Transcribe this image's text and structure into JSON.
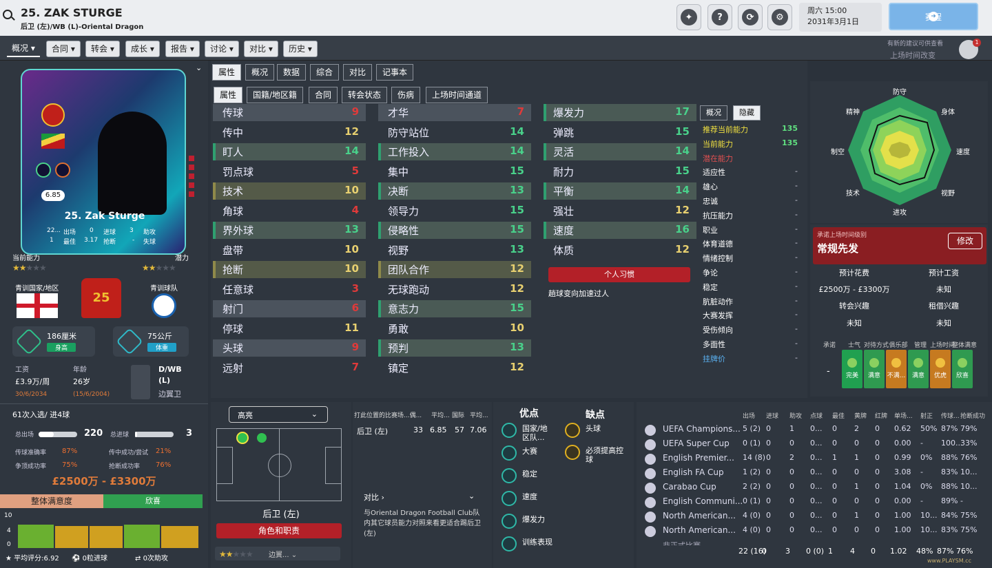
{
  "header": {
    "title": "25. ZAK STURGE",
    "subtitle": "后卫 (左)/WB (L)-Oriental Dragon",
    "day_time": "周六 15:00",
    "date": "2031年3月1日",
    "continue_label": "赛程",
    "help": "?"
  },
  "nav": {
    "tabs": [
      "概况",
      "合同",
      "转会",
      "成长",
      "报告",
      "讨论",
      "对比",
      "历史"
    ],
    "notif1": "有新的建议可供查看",
    "notif2": "上场时间改变",
    "notif_count": "1"
  },
  "card": {
    "rating": "6.85",
    "name": "25. Zak Sturge",
    "stats": [
      [
        "22...",
        "出场"
      ],
      [
        "0",
        "进球"
      ],
      [
        "3",
        "助攻"
      ],
      [
        "1",
        "最佳"
      ],
      [
        "3.17",
        "抢断"
      ],
      [
        "-",
        "失球"
      ]
    ],
    "current_label": "当前能力",
    "potential_label": "潜力"
  },
  "left": {
    "nation_label": "青训国家/地区",
    "club_label": "青训球队",
    "height": "186厘米",
    "height_tag": "身高",
    "weight": "75公斤",
    "weight_tag": "体重",
    "wage_label": "工资",
    "wage": "£3.9万/周",
    "wage_end": "30/6/2034",
    "age_label": "年龄",
    "age": "26岁",
    "dob": "(15/6/2004)",
    "pos1": "D/WB",
    "pos2": "(L)",
    "pos3": "边翼卫",
    "call": "61次入选/ 进4球",
    "apps_label": "总出场",
    "apps": "220",
    "goals_label": "总进球",
    "goals": "3",
    "pass_label": "传球准确率",
    "pass": "87%",
    "cross_label": "传中成功/尝试",
    "cross": "21%",
    "head_label": "争顶成功率",
    "head": "75%",
    "tackle_label": "抢断成功率",
    "tackle": "76%",
    "value": "£2500万 - £3300万",
    "sat_label": "整体满意度",
    "sat": "欣喜",
    "avg": "平均评分:6.92",
    "g0": "0粒进球",
    "a0": "0次助攻",
    "shirt": "25",
    "y10": "10",
    "y4": "4",
    "y0": "0"
  },
  "tabs1": [
    "属性",
    "概况",
    "数据",
    "综合",
    "对比",
    "记事本"
  ],
  "tabs2": [
    "属性",
    "国籍/地区籍",
    "合同",
    "转会状态",
    "伤病",
    "上场时间通道"
  ],
  "attrs1": [
    [
      "传球",
      "9",
      "r"
    ],
    [
      "传中",
      "12",
      "y"
    ],
    [
      "盯人",
      "14",
      "g"
    ],
    [
      "罚点球",
      "5",
      "r"
    ],
    [
      "技术",
      "10",
      "y"
    ],
    [
      "角球",
      "4",
      "r"
    ],
    [
      "界外球",
      "13",
      "g"
    ],
    [
      "盘带",
      "10",
      "y"
    ],
    [
      "抢断",
      "10",
      "y"
    ],
    [
      "任意球",
      "3",
      "r"
    ],
    [
      "射门",
      "6",
      "r"
    ],
    [
      "停球",
      "11",
      "y"
    ],
    [
      "头球",
      "9",
      "r"
    ],
    [
      "远射",
      "7",
      "r"
    ]
  ],
  "attrs2": [
    [
      "才华",
      "7",
      "r"
    ],
    [
      "防守站位",
      "14",
      "g"
    ],
    [
      "工作投入",
      "14",
      "g"
    ],
    [
      "集中",
      "15",
      "g"
    ],
    [
      "决断",
      "13",
      "g"
    ],
    [
      "领导力",
      "15",
      "g"
    ],
    [
      "侵略性",
      "15",
      "g"
    ],
    [
      "视野",
      "13",
      "g"
    ],
    [
      "团队合作",
      "12",
      "y"
    ],
    [
      "无球跑动",
      "12",
      "y"
    ],
    [
      "意志力",
      "15",
      "g"
    ],
    [
      "勇敢",
      "10",
      "y"
    ],
    [
      "预判",
      "13",
      "g"
    ],
    [
      "镇定",
      "12",
      "y"
    ]
  ],
  "attrs3": [
    [
      "爆发力",
      "17",
      "g"
    ],
    [
      "弹跳",
      "15",
      "g"
    ],
    [
      "灵活",
      "14",
      "g"
    ],
    [
      "耐力",
      "15",
      "g"
    ],
    [
      "平衡",
      "14",
      "g"
    ],
    [
      "强壮",
      "12",
      "y"
    ],
    [
      "速度",
      "16",
      "g"
    ],
    [
      "体质",
      "12",
      "y"
    ]
  ],
  "habit_label": "个人习惯",
  "habit": "趟球变向加速过人",
  "hidden": {
    "tab1": "概况",
    "tab2": "隐藏",
    "rows": [
      [
        "推荐当前能力",
        "135"
      ],
      [
        "当前能力",
        "135"
      ],
      [
        "潜在能力",
        ""
      ],
      [
        "适应性",
        "-"
      ],
      [
        "雄心",
        "-"
      ],
      [
        "忠诚",
        "-"
      ],
      [
        "抗压能力",
        "-"
      ],
      [
        "职业",
        "-"
      ],
      [
        "体育道德",
        "-"
      ],
      [
        "情绪控制",
        "-"
      ],
      [
        "争论",
        "-"
      ],
      [
        "稳定",
        "-"
      ],
      [
        "肮脏动作",
        "-"
      ],
      [
        "大赛发挥",
        "-"
      ],
      [
        "受伤倾向",
        "-"
      ],
      [
        "多面性",
        "-"
      ],
      [
        "挂牌价",
        "-"
      ]
    ]
  },
  "radar": [
    "防守",
    "身体",
    "速度",
    "视野",
    "进攻",
    "技术",
    "制空",
    "精神"
  ],
  "role": {
    "label": "承诺上场时间级别",
    "value": "常规先发",
    "edit": "修改",
    "fee_label": "预计花费",
    "wage_label": "预计工资",
    "fee": "£2500万 - £3300万",
    "wage": "未知",
    "transfer_label": "转会兴趣",
    "loan_label": "租借兴趣",
    "transfer": "未知",
    "loan": "未知"
  },
  "happy": {
    "labels": [
      "承诺",
      "士气",
      "对待方式",
      "俱乐部",
      "管理",
      "上场时间",
      "整体满意度"
    ],
    "dash": "-",
    "vals": [
      "完美",
      "满意",
      "不满...",
      "满意",
      "优虎",
      "欣喜"
    ]
  },
  "pitch": {
    "select": "高亮",
    "pos": "后卫 (左)",
    "role": "角色和职责",
    "role_sel": "边翼..."
  },
  "posperf": {
    "head": [
      "打此位置的比赛场...偶...",
      "平均...",
      "国际",
      "平均..."
    ],
    "row": [
      "后卫 (左)",
      "33",
      "6.85",
      "57",
      "7.06"
    ],
    "cmp": "对比",
    "text": "与Oriental Dragon Football Club队内其它球员能力对照来看更适合踢后卫 (左)"
  },
  "pros": {
    "title": "优点",
    "items": [
      "国家/地区队...",
      "大赛",
      "稳定",
      "速度",
      "爆发力",
      "训练表现"
    ]
  },
  "cons": {
    "title": "缺点",
    "items": [
      "头球",
      "必须提高控球"
    ]
  },
  "comp": {
    "head": [
      "出场",
      "进球",
      "助攻",
      "点球",
      "最佳",
      "黄牌",
      "红牌",
      "单场...",
      "射正",
      "传球...",
      "抢断成功"
    ],
    "rows": [
      [
        "UEFA Champions...",
        "5 (2)",
        "0",
        "1",
        "0...",
        "0",
        "2",
        "0",
        "0.62",
        "50%",
        "87%",
        "79%"
      ],
      [
        "UEFA Super Cup",
        "0 (1)",
        "0",
        "0",
        "0...",
        "0",
        "0",
        "0",
        "0.00",
        "-",
        "100...",
        "33%"
      ],
      [
        "English Premier...",
        "14 (8)",
        "0",
        "2",
        "0...",
        "1",
        "1",
        "0",
        "0.99",
        "0%",
        "88%",
        "76%"
      ],
      [
        "English FA Cup",
        "1 (2)",
        "0",
        "0",
        "0...",
        "0",
        "0",
        "0",
        "3.08",
        "-",
        "83%",
        "10..."
      ],
      [
        "Carabao Cup",
        "2 (2)",
        "0",
        "0",
        "0...",
        "0",
        "1",
        "0",
        "1.04",
        "0%",
        "88%",
        "10..."
      ],
      [
        "English Communi...",
        "0 (1)",
        "0",
        "0",
        "0...",
        "0",
        "0",
        "0",
        "0.00",
        "-",
        "89%",
        "-"
      ],
      [
        "North American...",
        "4 (0)",
        "0",
        "0",
        "0...",
        "0",
        "1",
        "0",
        "1.00",
        "10...",
        "84%",
        "75%"
      ],
      [
        "North American...",
        "4 (0)",
        "0",
        "0",
        "0...",
        "0",
        "0",
        "0",
        "1.00",
        "10...",
        "83%",
        "75%"
      ]
    ],
    "total": [
      "22 (16)",
      "0",
      "3",
      "0 (0)",
      "1",
      "4",
      "0",
      "1.02",
      "48%",
      "87%",
      "76%"
    ],
    "partial": "非正式比赛",
    "watermark": "www.PLAYSM.cc"
  }
}
